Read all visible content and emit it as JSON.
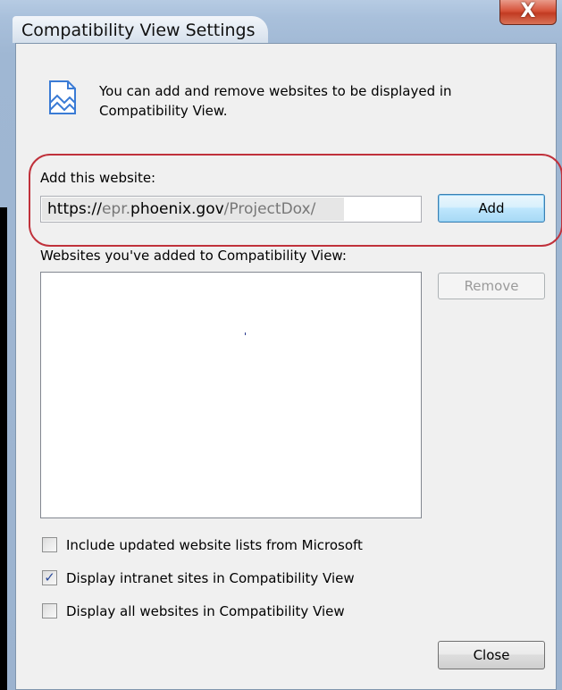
{
  "window": {
    "title": "Compatibility View Settings",
    "close_glyph": "X"
  },
  "info": {
    "icon": "compat-view-icon",
    "text": "You can add and remove websites to be displayed in Compatibility View."
  },
  "add_site": {
    "label": "Add this website:",
    "url_scheme": "https://",
    "url_sub": "epr.",
    "url_domain": "phoenix.gov",
    "url_path": "/ProjectDox/",
    "add_button": "Add"
  },
  "site_list": {
    "label": "Websites you've added to Compatibility View:",
    "items": [],
    "remove_button": "Remove"
  },
  "options": [
    {
      "label": "Include updated website lists from Microsoft",
      "checked": false
    },
    {
      "label": "Display intranet sites in Compatibility View",
      "checked": true
    },
    {
      "label": "Display all websites in Compatibility View",
      "checked": false
    }
  ],
  "close_button": "Close",
  "colors": {
    "annotation": "#c0313b",
    "checkmark": "#2b4b9a"
  }
}
